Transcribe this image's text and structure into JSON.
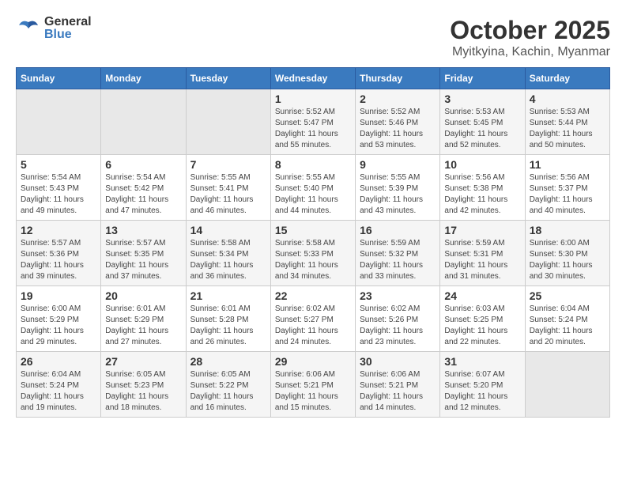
{
  "header": {
    "logo_general": "General",
    "logo_blue": "Blue",
    "month_title": "October 2025",
    "subtitle": "Myitkyina, Kachin, Myanmar"
  },
  "weekdays": [
    "Sunday",
    "Monday",
    "Tuesday",
    "Wednesday",
    "Thursday",
    "Friday",
    "Saturday"
  ],
  "weeks": [
    [
      {
        "day": "",
        "info": ""
      },
      {
        "day": "",
        "info": ""
      },
      {
        "day": "",
        "info": ""
      },
      {
        "day": "1",
        "info": "Sunrise: 5:52 AM\nSunset: 5:47 PM\nDaylight: 11 hours and 55 minutes."
      },
      {
        "day": "2",
        "info": "Sunrise: 5:52 AM\nSunset: 5:46 PM\nDaylight: 11 hours and 53 minutes."
      },
      {
        "day": "3",
        "info": "Sunrise: 5:53 AM\nSunset: 5:45 PM\nDaylight: 11 hours and 52 minutes."
      },
      {
        "day": "4",
        "info": "Sunrise: 5:53 AM\nSunset: 5:44 PM\nDaylight: 11 hours and 50 minutes."
      }
    ],
    [
      {
        "day": "5",
        "info": "Sunrise: 5:54 AM\nSunset: 5:43 PM\nDaylight: 11 hours and 49 minutes."
      },
      {
        "day": "6",
        "info": "Sunrise: 5:54 AM\nSunset: 5:42 PM\nDaylight: 11 hours and 47 minutes."
      },
      {
        "day": "7",
        "info": "Sunrise: 5:55 AM\nSunset: 5:41 PM\nDaylight: 11 hours and 46 minutes."
      },
      {
        "day": "8",
        "info": "Sunrise: 5:55 AM\nSunset: 5:40 PM\nDaylight: 11 hours and 44 minutes."
      },
      {
        "day": "9",
        "info": "Sunrise: 5:55 AM\nSunset: 5:39 PM\nDaylight: 11 hours and 43 minutes."
      },
      {
        "day": "10",
        "info": "Sunrise: 5:56 AM\nSunset: 5:38 PM\nDaylight: 11 hours and 42 minutes."
      },
      {
        "day": "11",
        "info": "Sunrise: 5:56 AM\nSunset: 5:37 PM\nDaylight: 11 hours and 40 minutes."
      }
    ],
    [
      {
        "day": "12",
        "info": "Sunrise: 5:57 AM\nSunset: 5:36 PM\nDaylight: 11 hours and 39 minutes."
      },
      {
        "day": "13",
        "info": "Sunrise: 5:57 AM\nSunset: 5:35 PM\nDaylight: 11 hours and 37 minutes."
      },
      {
        "day": "14",
        "info": "Sunrise: 5:58 AM\nSunset: 5:34 PM\nDaylight: 11 hours and 36 minutes."
      },
      {
        "day": "15",
        "info": "Sunrise: 5:58 AM\nSunset: 5:33 PM\nDaylight: 11 hours and 34 minutes."
      },
      {
        "day": "16",
        "info": "Sunrise: 5:59 AM\nSunset: 5:32 PM\nDaylight: 11 hours and 33 minutes."
      },
      {
        "day": "17",
        "info": "Sunrise: 5:59 AM\nSunset: 5:31 PM\nDaylight: 11 hours and 31 minutes."
      },
      {
        "day": "18",
        "info": "Sunrise: 6:00 AM\nSunset: 5:30 PM\nDaylight: 11 hours and 30 minutes."
      }
    ],
    [
      {
        "day": "19",
        "info": "Sunrise: 6:00 AM\nSunset: 5:29 PM\nDaylight: 11 hours and 29 minutes."
      },
      {
        "day": "20",
        "info": "Sunrise: 6:01 AM\nSunset: 5:29 PM\nDaylight: 11 hours and 27 minutes."
      },
      {
        "day": "21",
        "info": "Sunrise: 6:01 AM\nSunset: 5:28 PM\nDaylight: 11 hours and 26 minutes."
      },
      {
        "day": "22",
        "info": "Sunrise: 6:02 AM\nSunset: 5:27 PM\nDaylight: 11 hours and 24 minutes."
      },
      {
        "day": "23",
        "info": "Sunrise: 6:02 AM\nSunset: 5:26 PM\nDaylight: 11 hours and 23 minutes."
      },
      {
        "day": "24",
        "info": "Sunrise: 6:03 AM\nSunset: 5:25 PM\nDaylight: 11 hours and 22 minutes."
      },
      {
        "day": "25",
        "info": "Sunrise: 6:04 AM\nSunset: 5:24 PM\nDaylight: 11 hours and 20 minutes."
      }
    ],
    [
      {
        "day": "26",
        "info": "Sunrise: 6:04 AM\nSunset: 5:24 PM\nDaylight: 11 hours and 19 minutes."
      },
      {
        "day": "27",
        "info": "Sunrise: 6:05 AM\nSunset: 5:23 PM\nDaylight: 11 hours and 18 minutes."
      },
      {
        "day": "28",
        "info": "Sunrise: 6:05 AM\nSunset: 5:22 PM\nDaylight: 11 hours and 16 minutes."
      },
      {
        "day": "29",
        "info": "Sunrise: 6:06 AM\nSunset: 5:21 PM\nDaylight: 11 hours and 15 minutes."
      },
      {
        "day": "30",
        "info": "Sunrise: 6:06 AM\nSunset: 5:21 PM\nDaylight: 11 hours and 14 minutes."
      },
      {
        "day": "31",
        "info": "Sunrise: 6:07 AM\nSunset: 5:20 PM\nDaylight: 11 hours and 12 minutes."
      },
      {
        "day": "",
        "info": ""
      }
    ]
  ]
}
